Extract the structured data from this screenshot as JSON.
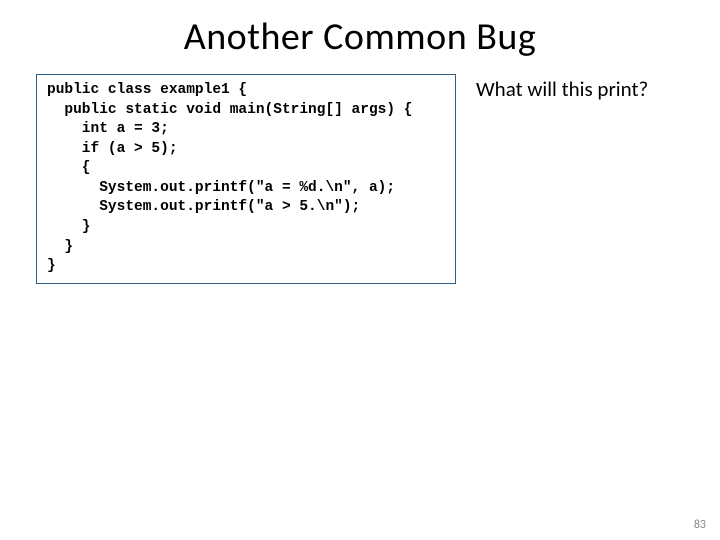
{
  "title": "Another Common Bug",
  "question": "What will this print?",
  "page_number": "83",
  "code": {
    "l1": "public class example1 {",
    "l2": "  public static void main(String[] args) {",
    "l3": "    int a = 3;",
    "l4": "    if (a > 5);",
    "l5": "    {",
    "l6": "      System.out.printf(\"a = %d.\\n\", a);",
    "l7": "      System.out.printf(\"a > 5.\\n\");",
    "l8": "    }",
    "l9": "  }",
    "l10": "}"
  }
}
